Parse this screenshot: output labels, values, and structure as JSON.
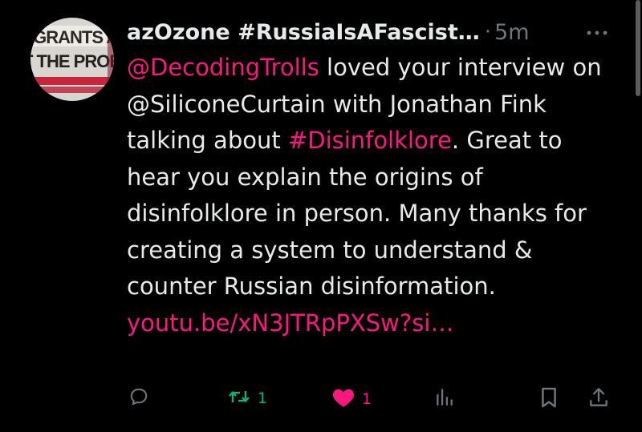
{
  "tweet": {
    "author_display_name": "azOzone #RussiaIsAFascist…",
    "separator": "·",
    "timestamp": "5m",
    "avatar_text_line1": "IGRANTS A",
    "avatar_text_line2": "T THE PROBL",
    "body": {
      "mention1": "@DecodingTrolls",
      "text1": " loved your interview on @SiliconeCurtain with Jonathan Fink talking about ",
      "hashtag": "#Disinfolklore",
      "text2": ". Great to hear you explain the origins of disinfolklore in person. Many thanks for creating a system to understand & counter Russian disinformation.",
      "link": "youtu.be/xN3JTRpPXSw?si…"
    },
    "actions": {
      "reply_icon": "reply-icon",
      "retweet_icon": "retweet-icon",
      "retweet_count": "1",
      "like_icon": "heart-icon",
      "like_count": "1",
      "views_icon": "views-icon",
      "bookmark_icon": "bookmark-icon",
      "share_icon": "share-icon"
    }
  },
  "colors": {
    "background": "#000000",
    "text": "#e7e9ea",
    "muted": "#71767b",
    "link": "#f91880",
    "retweet_active": "#00ba7c",
    "like_active": "#f91880"
  }
}
